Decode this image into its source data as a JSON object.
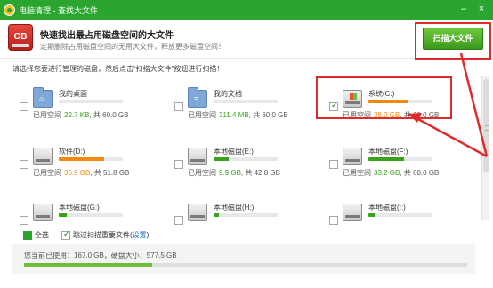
{
  "window": {
    "title": "电脑清理 - 查找大文件",
    "minimize_glyph": "–",
    "close_glyph": "×"
  },
  "header": {
    "title": "快速找出最占用磁盘空间的大文件",
    "subtitle": "定期删除占用磁盘空间的无用大文件，释放更多磁盘空间！",
    "icon_text": "GB"
  },
  "scan_button": {
    "label": "扫描大文件"
  },
  "instruction": "请选择您要进行管理的磁盘，然后点击“扫描大文件”按钮进行扫描！",
  "drives": [
    {
      "name": "我的桌面",
      "used_label": "已用空间",
      "used": "22.7 KB",
      "total": ", 共 60.0 GB",
      "checked": false,
      "icon": "desktop-folder-icon",
      "usage_fraction": 0.0,
      "color": "#3aa31c"
    },
    {
      "name": "我的文档",
      "used_label": "已用空间",
      "used": "311.4 MB",
      "total": ", 共 60.0 GB",
      "checked": false,
      "icon": "documents-folder-icon",
      "usage_fraction": 0.01,
      "color": "#3aa31c"
    },
    {
      "name": "系统(C:)",
      "used_label": "已用空间",
      "used": "38.0 GB",
      "total": ", 共 60.0 GB",
      "checked": true,
      "icon": "system-drive-icon",
      "usage_fraction": 0.63,
      "color": "#f08a0c"
    },
    {
      "name": "软件(D:)",
      "used_label": "已用空间",
      "used": "36.9 GB",
      "total": ", 共 51.8 GB",
      "checked": false,
      "icon": "hard-drive-icon",
      "usage_fraction": 0.71,
      "color": "#f08a0c"
    },
    {
      "name": "本地磁盘(E:)",
      "used_label": "已用空间",
      "used": "9.9 GB",
      "total": ", 共 42.8 GB",
      "checked": false,
      "icon": "hard-drive-icon",
      "usage_fraction": 0.23,
      "color": "#3aa31c"
    },
    {
      "name": "本地磁盘(F:)",
      "used_label": "已用空间",
      "used": "33.2 GB",
      "total": ", 共 60.0 GB",
      "checked": false,
      "icon": "hard-drive-icon",
      "usage_fraction": 0.55,
      "color": "#3aa31c"
    },
    {
      "name": "本地磁盘(G:)",
      "used_label": "",
      "used": "",
      "total": "",
      "checked": false,
      "icon": "hard-drive-icon",
      "usage_fraction": 0.12,
      "color": "#3aa31c"
    },
    {
      "name": "本地磁盘(H:)",
      "used_label": "",
      "used": "",
      "total": "",
      "checked": false,
      "icon": "hard-drive-icon",
      "usage_fraction": 0.08,
      "color": "#3aa31c"
    },
    {
      "name": "本地磁盘(I:)",
      "used_label": "",
      "used": "",
      "total": "",
      "checked": false,
      "icon": "hard-drive-icon",
      "usage_fraction": 0.1,
      "color": "#3aa31c"
    }
  ],
  "footer": {
    "select_all_label": "全选",
    "skip_label": "跳过扫描重要文件(",
    "settings_link": "设置",
    "skip_suffix": ")",
    "usage_summary": "您当前已使用：167.0 GB，硬盘大小：577.5 GB",
    "usage_fraction": 0.289
  },
  "colors": {
    "accent_green": "#2aa52f",
    "highlight_red": "#e12a2a",
    "warning_orange": "#f08a0c"
  }
}
